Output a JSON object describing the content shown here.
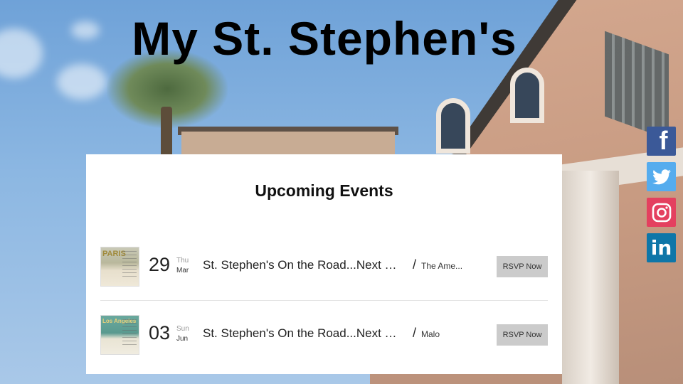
{
  "page": {
    "title": "My St. Stephen's"
  },
  "social": [
    {
      "icon": "facebook-icon",
      "label": "f",
      "color": "#3b5998"
    },
    {
      "icon": "twitter-icon",
      "label": "",
      "color": "#55acee"
    },
    {
      "icon": "instagram-icon",
      "label": "",
      "color": "#e4405f"
    },
    {
      "icon": "linkedin-icon",
      "label": "in",
      "color": "#0e76a8"
    }
  ],
  "events": {
    "heading": "Upcoming Events",
    "items": [
      {
        "thumb_text": "PARIS",
        "day": "29",
        "weekday": "Thu",
        "month": "Mar",
        "title": "St. Stephen's On the Road...Next Stop Paris",
        "location": "The Ame...",
        "rsvp": "RSVP Now"
      },
      {
        "thumb_text": "Los Angeles",
        "day": "03",
        "weekday": "Sun",
        "month": "Jun",
        "title": "St. Stephen's On the Road...Next Stop Los Angeles",
        "location": "Malo",
        "rsvp": "RSVP Now"
      }
    ]
  }
}
